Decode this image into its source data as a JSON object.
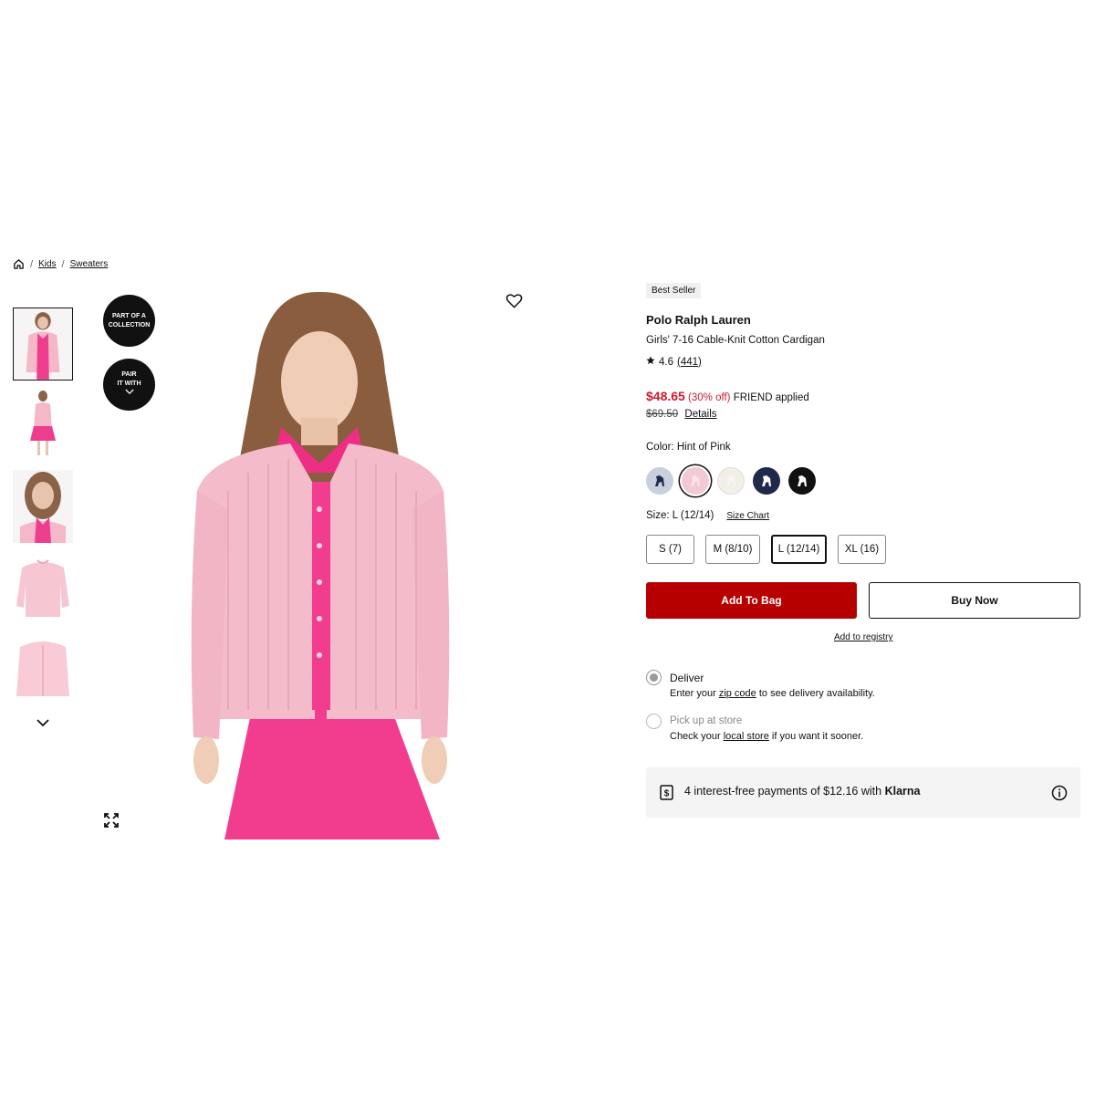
{
  "breadcrumb": {
    "home_icon": "home-icon",
    "items": [
      "Kids",
      "Sweaters"
    ]
  },
  "collection_button": {
    "line1": "PART OF A",
    "line2": "COLLECTION"
  },
  "pair_button": {
    "line1": "PAIR",
    "line2": "IT WITH",
    "icon": "chevron-down-icon"
  },
  "product": {
    "badge": "Best Seller",
    "brand": "Polo Ralph Lauren",
    "title": "Girls' 7-16 Cable-Knit Cotton Cardigan",
    "rating": "4.6",
    "review_count": "(441)",
    "sale_price": "$48.65",
    "discount": "(30% off)",
    "promo": "FRIEND applied",
    "original_price": "$69.50",
    "details_link": "Details",
    "color_label": "Color: Hint of Pink",
    "size_label": "Size: L (12/14)",
    "size_chart": "Size Chart",
    "sizes": [
      "S (7)",
      "M (8/10)",
      "L (12/14)",
      "XL (16)"
    ],
    "selected_size": "L (12/14)",
    "swatch_colors": [
      "#c8d0de",
      "#f2c9d4",
      "#f1efe6",
      "#1f2a4a",
      "#111111"
    ],
    "accent_color": "#b60000",
    "sale_color": "#d01b2c"
  },
  "actions": {
    "add_to_bag": "Add To Bag",
    "buy_now": "Buy Now",
    "registry": "Add to registry"
  },
  "fulfillment": {
    "deliver_title": "Deliver",
    "deliver_pre": "Enter your ",
    "deliver_link": "zip code",
    "deliver_post": " to see delivery availability.",
    "pickup_title": "Pick up at store",
    "pickup_pre": "Check your ",
    "pickup_link": "local store",
    "pickup_post": " if you want it sooner."
  },
  "klarna": {
    "text": "4 interest-free payments of $12.16 with ",
    "brand": "Klarna"
  }
}
